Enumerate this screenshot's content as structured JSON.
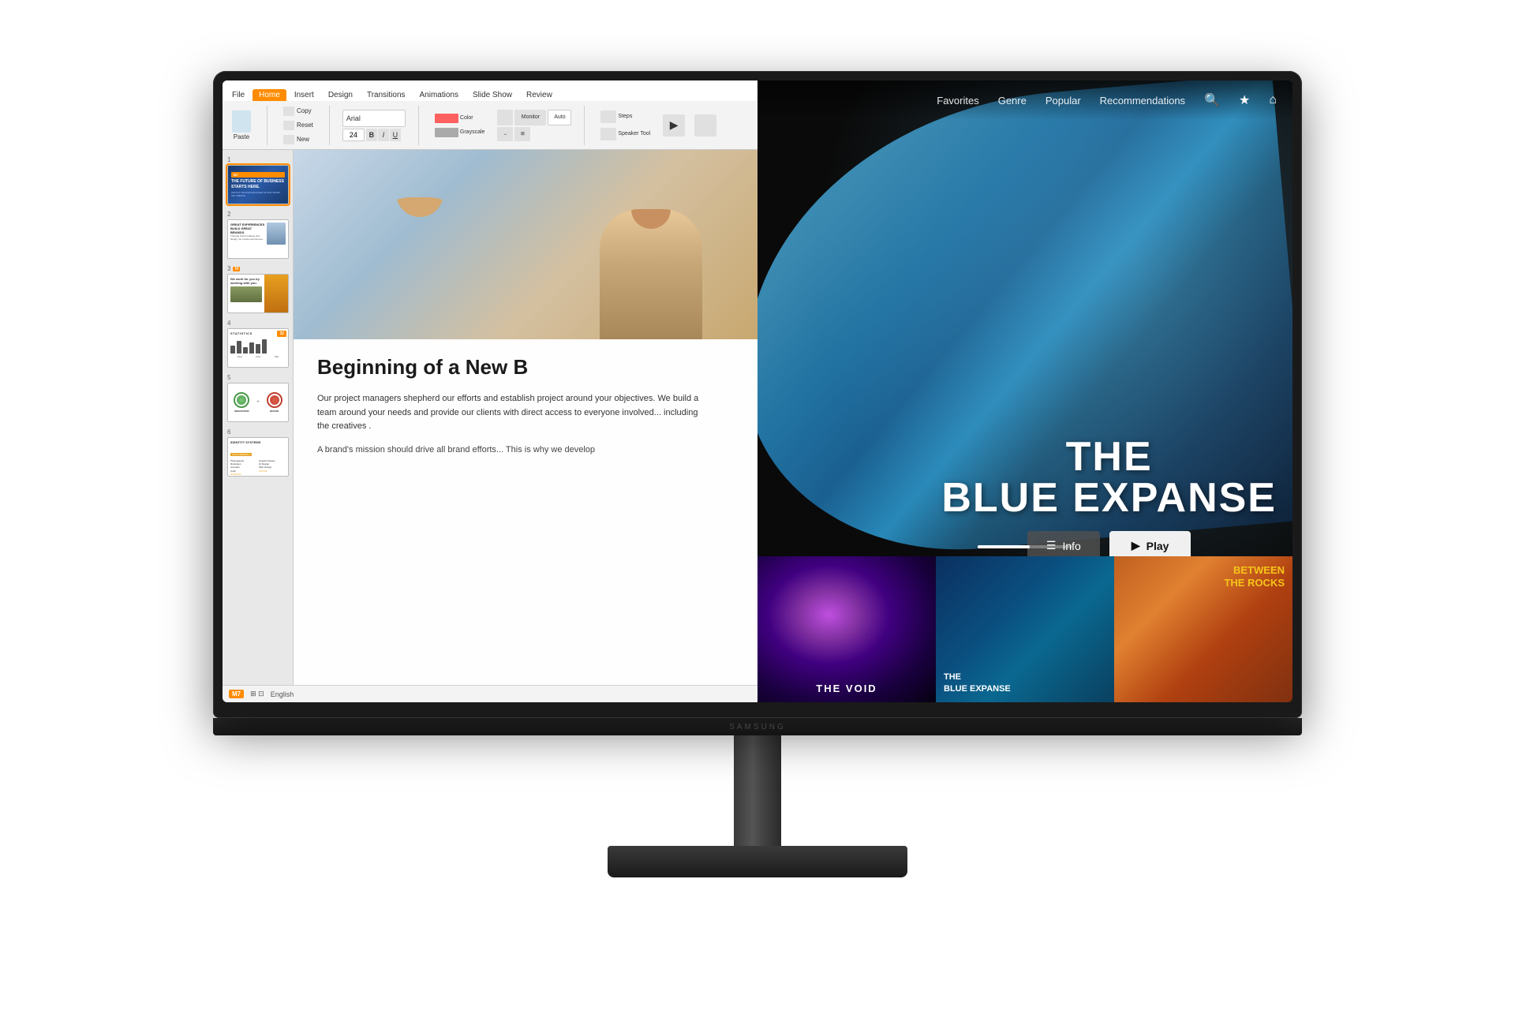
{
  "monitor": {
    "brand": "SAMSUNG"
  },
  "powerpoint": {
    "tabs": [
      "File",
      "Home",
      "Insert",
      "Design",
      "Transitions",
      "Animations",
      "Slide Show",
      "Review"
    ],
    "active_tab": "Home",
    "slides": [
      {
        "num": "1",
        "title": "THE FUTURE OF BUSINESS STARTS HERE.",
        "sub": "WE PUT PEOPLE ENGAGED IN OUR WORK. WE CREATE."
      },
      {
        "num": "2",
        "title": "GREAT EXPERIENCES BUILD GREAT BRANDS.",
        "body": "Through brand strategy and design, we create experiences that engage and well as more of the world."
      },
      {
        "num": "3",
        "title": "",
        "has_orange": true
      },
      {
        "num": "4",
        "title": "STATISTICS",
        "badge": "32"
      },
      {
        "num": "5",
        "title": "INNOVATION    BRAND"
      },
      {
        "num": "6",
        "title": "IDENTITY SYSTEMS",
        "sub_badge": "UX/UI DESIGN"
      }
    ],
    "main_slide": {
      "title": "Beginning of a New B",
      "body1": "Our project managers shepherd our efforts and establish project around your objectives. We build a team around your needs and provide our clients with direct access to everyone involved... including the creatives .",
      "body2": "A brand's mission should drive all brand efforts... This is why we develop"
    },
    "status_bar": {
      "slide_info": "M7",
      "view_icons": "⊞ ⊡",
      "language": "English"
    }
  },
  "streaming": {
    "nav_items": [
      "Favorites",
      "Genre",
      "Popular",
      "Recommendations"
    ],
    "icons": {
      "search": "🔍",
      "favorites": "★",
      "home": "⌂"
    },
    "hero": {
      "title_line1": "THE",
      "title_line2": "BLUE EXPANSE"
    },
    "buttons": {
      "info": "Info",
      "play": "Play"
    },
    "thumbnails": [
      {
        "id": "the-void",
        "title": "THE VOID",
        "bg": "void"
      },
      {
        "id": "the-blue-expanse",
        "title": "THE\nBLUE EXPANSE",
        "bg": "ocean"
      },
      {
        "id": "between-the-rocks",
        "title": "BETWEEN\nTHE ROCKS",
        "bg": "canyon"
      }
    ]
  }
}
